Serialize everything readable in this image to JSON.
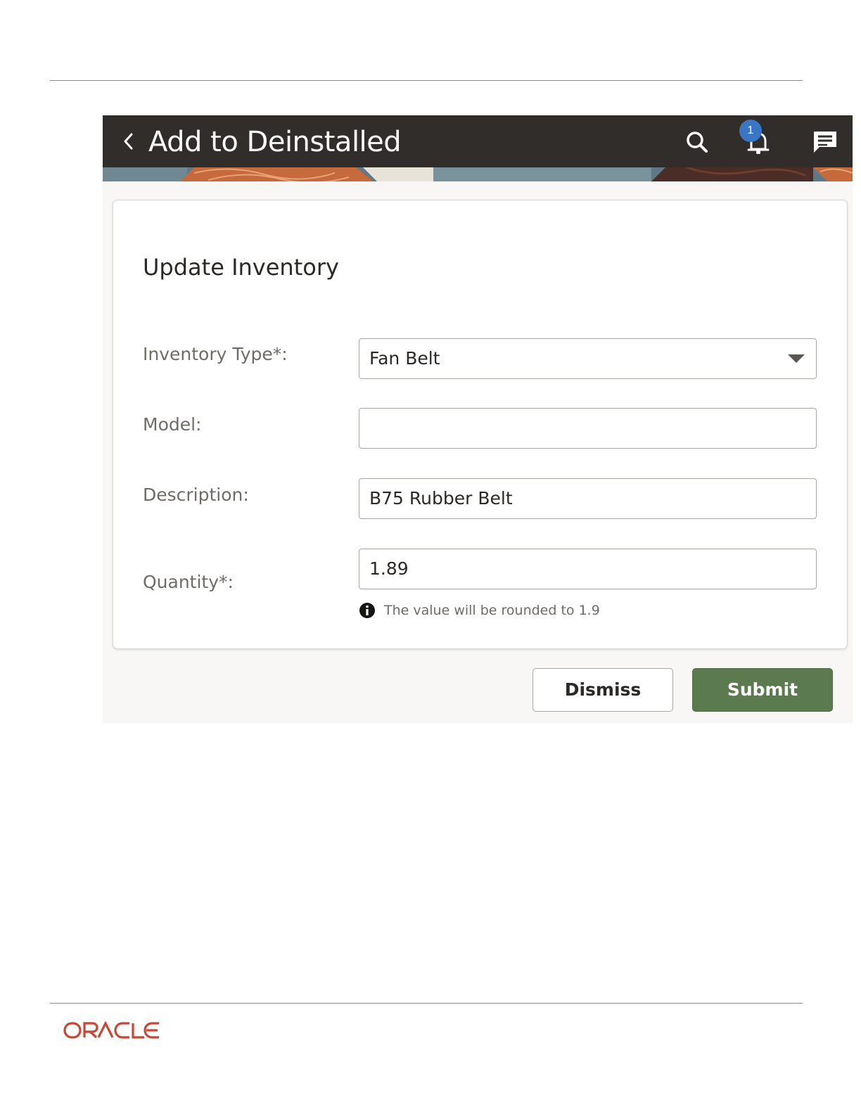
{
  "document": {
    "logo_text": "ORACLE"
  },
  "app": {
    "title": "Add to Deinstalled",
    "notification_count": "1",
    "icons": {
      "back": "chevron-left-icon",
      "search": "search-icon",
      "notifications": "bell-icon",
      "messages": "chat-icon"
    },
    "colors": {
      "header_bg": "#312d2a",
      "badge_bg": "#3a76c4",
      "submit_bg": "#5b7a4f"
    }
  },
  "form": {
    "title": "Update Inventory",
    "fields": [
      {
        "label": "Inventory Type*:",
        "value": "Fan Belt",
        "type": "select"
      },
      {
        "label": "Model:",
        "value": "",
        "type": "text"
      },
      {
        "label": "Description:",
        "value": "B75 Rubber Belt",
        "type": "text"
      },
      {
        "label": "Quantity*:",
        "value": "1.89",
        "type": "number"
      }
    ],
    "quantity_hint": "The value will be rounded to 1.9"
  },
  "actions": {
    "dismiss_label": "Dismiss",
    "submit_label": "Submit"
  }
}
